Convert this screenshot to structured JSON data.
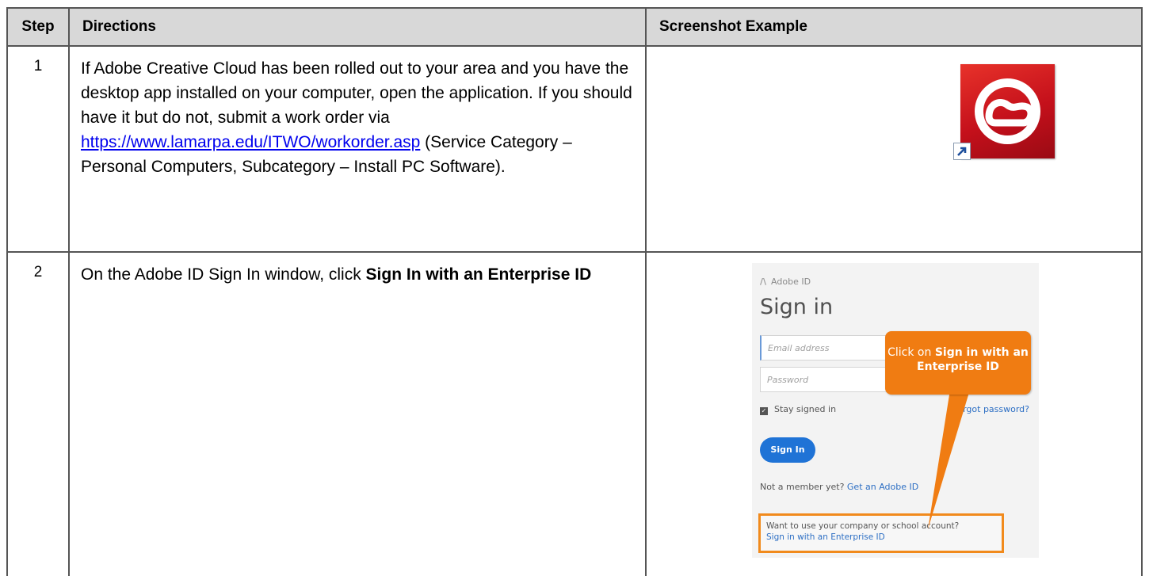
{
  "table": {
    "headers": {
      "step": "Step",
      "directions": "Directions",
      "screenshot": "Screenshot Example"
    },
    "rows": [
      {
        "step": "1",
        "text_before_link": "If Adobe Creative Cloud has been rolled out to your area and you have the desktop app installed on your computer, open the application. If you should have it but do not, submit a work order via",
        "link": "https://www.lamarpa.edu/ITWO/workorder.asp",
        "text_after_link": "(Service Category – Personal Computers, Subcategory – Install PC Software)."
      },
      {
        "step": "2",
        "text_before_bold": "On the Adobe ID Sign In window, click",
        "bold": "Sign In with an Enterprise ID"
      }
    ]
  },
  "signin_mock": {
    "brand": "Adobe ID",
    "title": "Sign in",
    "email_placeholder": "Email address",
    "password_placeholder": "Password",
    "stay_signed_in": "Stay signed in",
    "forgot_password": "Forgot password?",
    "sign_in_button": "Sign In",
    "not_member": "Not a member yet?",
    "get_adobe_id": "Get an Adobe ID",
    "enterprise_question": "Want to use your company or school account?",
    "enterprise_link": "Sign in with an Enterprise ID",
    "callout_prefix": "Click on",
    "callout_bold": "Sign in with an Enterprise ID"
  },
  "colors": {
    "header_bg": "#d8d8d8",
    "callout": "#f07c12",
    "link": "#0000ee",
    "cc_red": "#d41f26"
  },
  "icons": {
    "app_icon": "creative-cloud-icon",
    "shortcut": "shortcut-arrow-icon"
  }
}
